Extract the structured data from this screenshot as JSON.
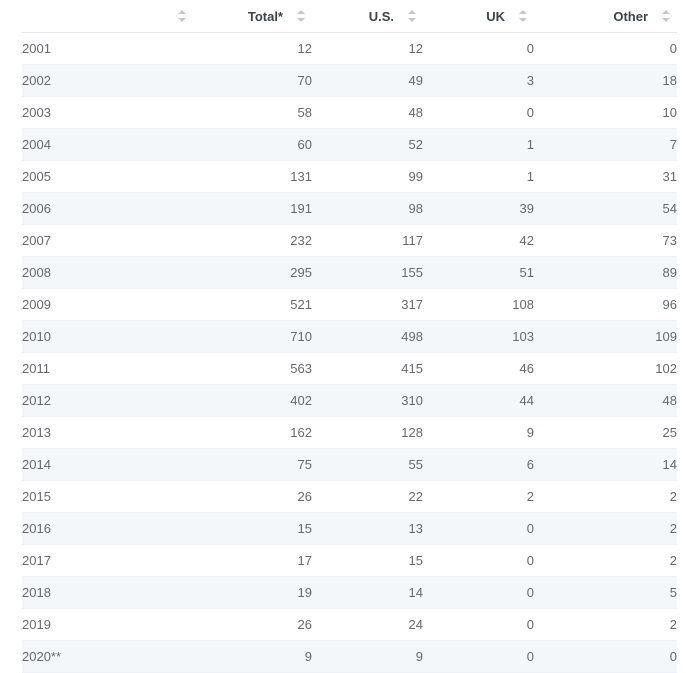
{
  "table": {
    "columns": [
      {
        "key": "year",
        "label": "",
        "align": "left",
        "sortable": true,
        "sort_icon": "sort-updown-icon"
      },
      {
        "key": "total",
        "label": "Total*",
        "align": "right",
        "sortable": true,
        "sort_icon": "sort-updown-icon"
      },
      {
        "key": "us",
        "label": "U.S.",
        "align": "right",
        "sortable": true,
        "sort_icon": "sort-updown-icon"
      },
      {
        "key": "uk",
        "label": "UK",
        "align": "right",
        "sortable": true,
        "sort_icon": "sort-updown-icon"
      },
      {
        "key": "other",
        "label": "Other",
        "align": "right",
        "sortable": true,
        "sort_icon": "sort-updown-icon"
      }
    ],
    "rows": [
      {
        "year": "2001",
        "total": "12",
        "us": "12",
        "uk": "0",
        "other": "0"
      },
      {
        "year": "2002",
        "total": "70",
        "us": "49",
        "uk": "3",
        "other": "18"
      },
      {
        "year": "2003",
        "total": "58",
        "us": "48",
        "uk": "0",
        "other": "10"
      },
      {
        "year": "2004",
        "total": "60",
        "us": "52",
        "uk": "1",
        "other": "7"
      },
      {
        "year": "2005",
        "total": "131",
        "us": "99",
        "uk": "1",
        "other": "31"
      },
      {
        "year": "2006",
        "total": "191",
        "us": "98",
        "uk": "39",
        "other": "54"
      },
      {
        "year": "2007",
        "total": "232",
        "us": "117",
        "uk": "42",
        "other": "73"
      },
      {
        "year": "2008",
        "total": "295",
        "us": "155",
        "uk": "51",
        "other": "89"
      },
      {
        "year": "2009",
        "total": "521",
        "us": "317",
        "uk": "108",
        "other": "96"
      },
      {
        "year": "2010",
        "total": "710",
        "us": "498",
        "uk": "103",
        "other": "109"
      },
      {
        "year": "2011",
        "total": "563",
        "us": "415",
        "uk": "46",
        "other": "102"
      },
      {
        "year": "2012",
        "total": "402",
        "us": "310",
        "uk": "44",
        "other": "48"
      },
      {
        "year": "2013",
        "total": "162",
        "us": "128",
        "uk": "9",
        "other": "25"
      },
      {
        "year": "2014",
        "total": "75",
        "us": "55",
        "uk": "6",
        "other": "14"
      },
      {
        "year": "2015",
        "total": "26",
        "us": "22",
        "uk": "2",
        "other": "2"
      },
      {
        "year": "2016",
        "total": "15",
        "us": "13",
        "uk": "0",
        "other": "2"
      },
      {
        "year": "2017",
        "total": "17",
        "us": "15",
        "uk": "0",
        "other": "2"
      },
      {
        "year": "2018",
        "total": "19",
        "us": "14",
        "uk": "0",
        "other": "5"
      },
      {
        "year": "2019",
        "total": "26",
        "us": "24",
        "uk": "0",
        "other": "2"
      },
      {
        "year": "2020**",
        "total": "9",
        "us": "9",
        "uk": "0",
        "other": "0"
      }
    ]
  },
  "chart_data": {
    "type": "table",
    "title": "",
    "categories": [
      "2001",
      "2002",
      "2003",
      "2004",
      "2005",
      "2006",
      "2007",
      "2008",
      "2009",
      "2010",
      "2011",
      "2012",
      "2013",
      "2014",
      "2015",
      "2016",
      "2017",
      "2018",
      "2019",
      "2020**"
    ],
    "series": [
      {
        "name": "Total*",
        "values": [
          12,
          70,
          58,
          60,
          131,
          191,
          232,
          295,
          521,
          710,
          563,
          402,
          162,
          75,
          26,
          15,
          17,
          19,
          26,
          9
        ]
      },
      {
        "name": "U.S.",
        "values": [
          12,
          49,
          48,
          52,
          99,
          98,
          117,
          155,
          317,
          498,
          415,
          310,
          128,
          55,
          22,
          13,
          15,
          14,
          24,
          9
        ]
      },
      {
        "name": "UK",
        "values": [
          0,
          3,
          0,
          1,
          1,
          39,
          42,
          51,
          108,
          103,
          46,
          44,
          9,
          6,
          2,
          0,
          0,
          0,
          0,
          0
        ]
      },
      {
        "name": "Other",
        "values": [
          0,
          18,
          10,
          7,
          31,
          54,
          73,
          89,
          96,
          109,
          102,
          48,
          25,
          14,
          2,
          2,
          2,
          5,
          2,
          0
        ]
      }
    ],
    "xlabel": "",
    "ylabel": "",
    "grid": false,
    "legend": "none"
  },
  "colors": {
    "stripe": "#f4f7fa",
    "header_text": "#3c434b",
    "body_text": "#63696f",
    "row_border": "#eef1f5",
    "header_border": "#e4e8ed",
    "sort_icon": "#c3c8cf"
  }
}
